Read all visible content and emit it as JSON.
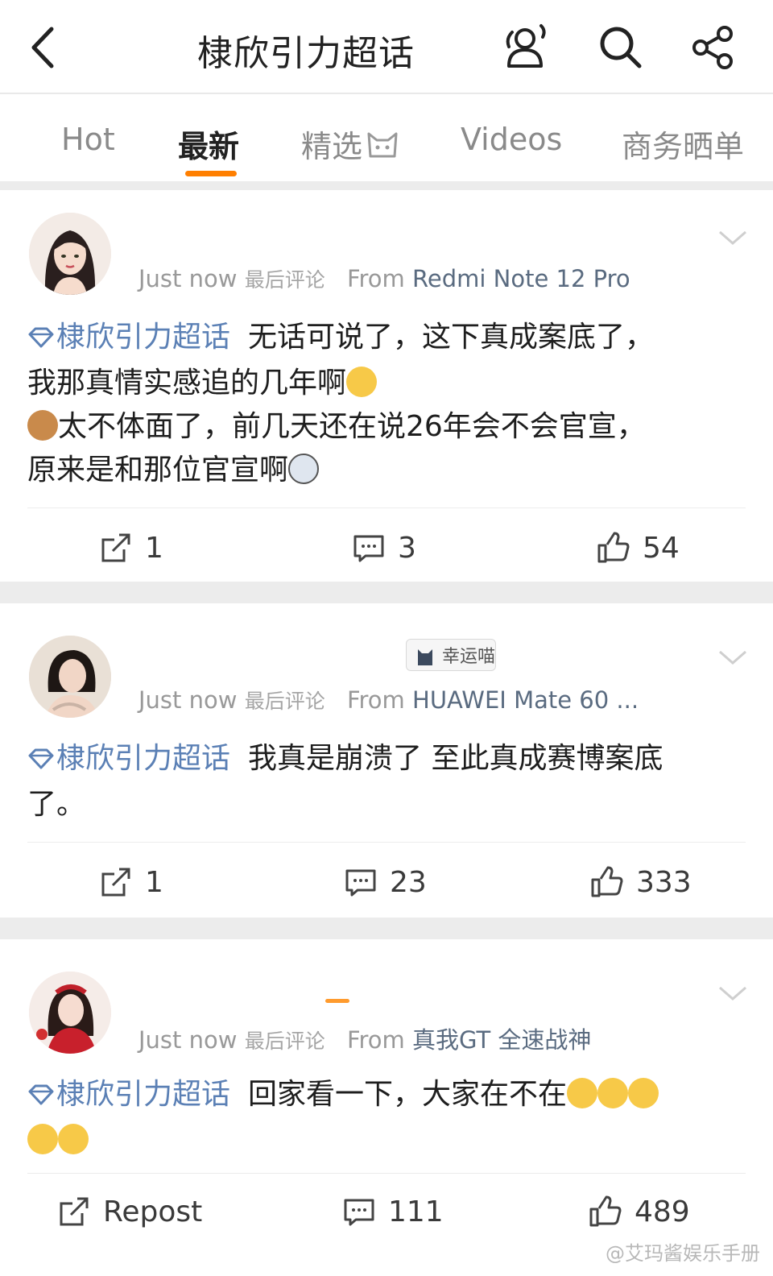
{
  "header": {
    "title": "棣欣引力超话"
  },
  "tabs": [
    {
      "label": "Hot"
    },
    {
      "label": "最新"
    },
    {
      "label": "精选"
    },
    {
      "label": "Videos"
    },
    {
      "label": "商务晒单"
    }
  ],
  "posts": [
    {
      "time": "Just now",
      "hint": "最后评论",
      "from_label": "From",
      "device": "Redmi Note 12 Pro",
      "topic": "棣欣引力超话",
      "lines": [
        "无话可说了，这下真成案底了，",
        "我那真情实感追的几年啊",
        "太不体面了，前几天还在说26年会不会官宣，",
        "原来是和那位官宣啊"
      ],
      "reposts": "1",
      "comments": "3",
      "likes": "54"
    },
    {
      "badge": "幸运喵",
      "time": "Just now",
      "hint": "最后评论",
      "from_label": "From",
      "device": "HUAWEI Mate 60 ...",
      "topic": "棣欣引力超话",
      "lines": [
        "我真是崩溃了 至此真成赛博案底",
        "了。"
      ],
      "reposts": "1",
      "comments": "23",
      "likes": "333"
    },
    {
      "time": "Just now",
      "hint": "最后评论",
      "from_label": "From",
      "device": "真我GT 全速战神",
      "topic": "棣欣引力超话",
      "lines": [
        "回家看一下，大家在不在"
      ],
      "reposts": "Repost",
      "comments": "111",
      "likes": "489"
    }
  ],
  "watermark": "@艾玛酱娱乐手册",
  "colors": {
    "accent": "#ff7f00",
    "topic": "#5b80b5",
    "device": "#5a6b80"
  }
}
